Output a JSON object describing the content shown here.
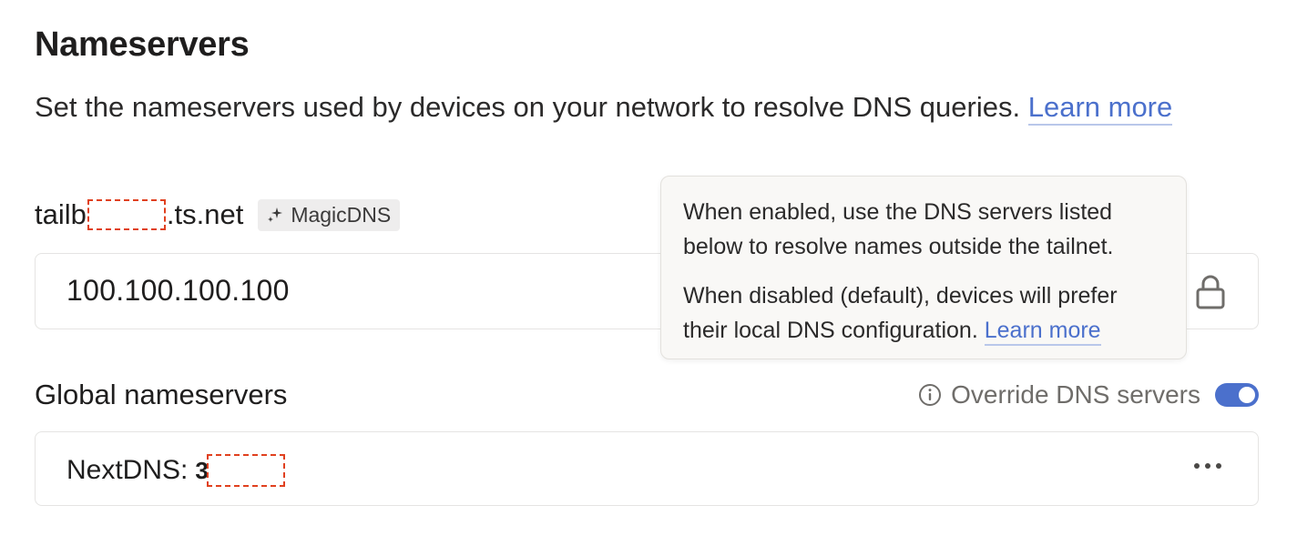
{
  "section": {
    "title": "Nameservers",
    "description": "Set the nameservers used by devices on your network to resolve DNS queries.",
    "learn_more": "Learn more"
  },
  "tailnet": {
    "name_prefix": "tailb",
    "name_suffix": ".ts.net",
    "badge_icon": "sparkle-icon",
    "badge_label": "MagicDNS",
    "nameserver_value": "100.100.100.100",
    "lock_icon": "lock-icon"
  },
  "tooltip": {
    "paragraph1": "When enabled, use the DNS servers listed below to resolve names outside the tailnet.",
    "paragraph2": "When disabled (default), devices will prefer their local DNS configuration.",
    "learn_more": "Learn more"
  },
  "global": {
    "label": "Global nameservers",
    "override_label": "Override DNS servers",
    "override_enabled": true,
    "info_icon": "info-icon"
  },
  "nameservers": [
    {
      "label": "NextDNS:",
      "value_prefix": "3"
    }
  ],
  "colors": {
    "accent": "#4b70cc",
    "redaction": "#e0401f",
    "tooltip_bg": "#f9f8f6"
  }
}
